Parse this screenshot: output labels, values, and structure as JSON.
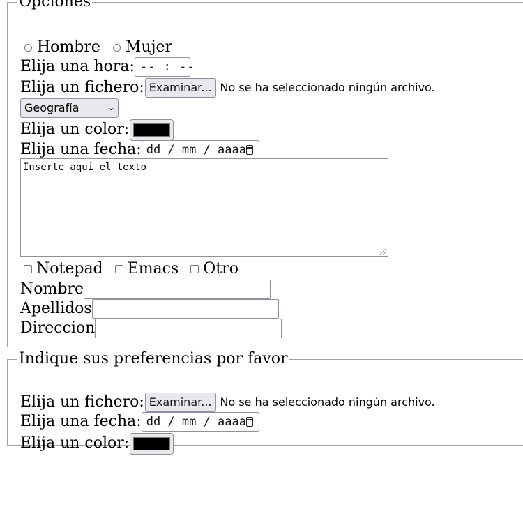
{
  "fieldset1": {
    "legend": "Opciones",
    "radio_options": [
      "Hombre",
      "Mujer"
    ],
    "time_label": "Elija una hora:",
    "time_value": "-- : --",
    "file_label": "Elija un fichero:",
    "file_button": "Examinar...",
    "file_status": "No se ha seleccionado ningún archivo.",
    "select_value": "Geografía",
    "color_label": "Elija un color:",
    "color_value": "#000000",
    "date_label": "Elija una fecha:",
    "date_placeholder": "dd / mm / aaaa",
    "textarea_value": "Inserte aqui el texto",
    "checkbox_options": [
      "Notepad",
      "Emacs",
      "Otro"
    ],
    "name_label": "Nombre",
    "surname_label": "Apellidos",
    "address_label": "Direccion"
  },
  "fieldset2": {
    "legend": "Indique sus preferencias por favor",
    "file_label": "Elija un fichero:",
    "file_button": "Examinar...",
    "file_status": "No se ha seleccionado ningún archivo.",
    "date_label": "Elija una fecha:",
    "date_placeholder": "dd / mm / aaaa",
    "color_label": "Elija un color:",
    "color_value": "#000000"
  }
}
